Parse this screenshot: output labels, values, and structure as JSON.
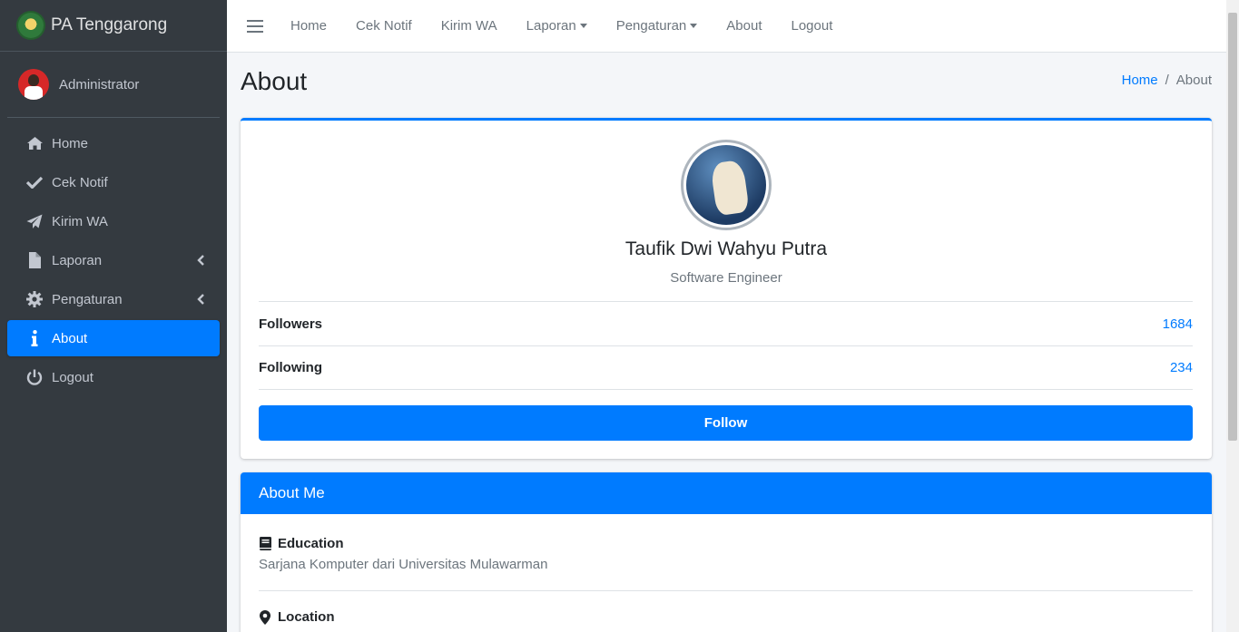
{
  "brand": {
    "name": "PA Tenggarong",
    "logo_icon": "court-emblem-icon"
  },
  "user_panel": {
    "name": "Administrator"
  },
  "sidebar": {
    "items": [
      {
        "label": "Home",
        "icon": "home-icon",
        "active": false,
        "has_arrow": false
      },
      {
        "label": "Cek Notif",
        "icon": "check-icon",
        "active": false,
        "has_arrow": false
      },
      {
        "label": "Kirim WA",
        "icon": "paper-plane-icon",
        "active": false,
        "has_arrow": false
      },
      {
        "label": "Laporan",
        "icon": "file-icon",
        "active": false,
        "has_arrow": true
      },
      {
        "label": "Pengaturan",
        "icon": "gear-icon",
        "active": false,
        "has_arrow": true
      },
      {
        "label": "About",
        "icon": "info-icon",
        "active": true,
        "has_arrow": false
      },
      {
        "label": "Logout",
        "icon": "power-icon",
        "active": false,
        "has_arrow": false
      }
    ]
  },
  "topnav": {
    "links": [
      "Home",
      "Cek Notif",
      "Kirim WA",
      "Laporan",
      "Pengaturan",
      "About",
      "Logout"
    ],
    "dropdowns": [
      "Laporan",
      "Pengaturan"
    ]
  },
  "header": {
    "title": "About",
    "breadcrumb": {
      "home": "Home",
      "current": "About",
      "separator": "/"
    }
  },
  "profile": {
    "name": "Taufik Dwi Wahyu Putra",
    "job": "Software Engineer",
    "followers_label": "Followers",
    "followers_value": "1684",
    "following_label": "Following",
    "following_value": "234",
    "follow_button": "Follow"
  },
  "about_me": {
    "title": "About Me",
    "education_label": "Education",
    "education_text": "Sarjana Komputer dari Universitas Mulawarman",
    "location_label": "Location"
  },
  "colors": {
    "sidebar_bg": "#343a40",
    "primary": "#007bff",
    "content_bg": "#f4f6f9"
  }
}
